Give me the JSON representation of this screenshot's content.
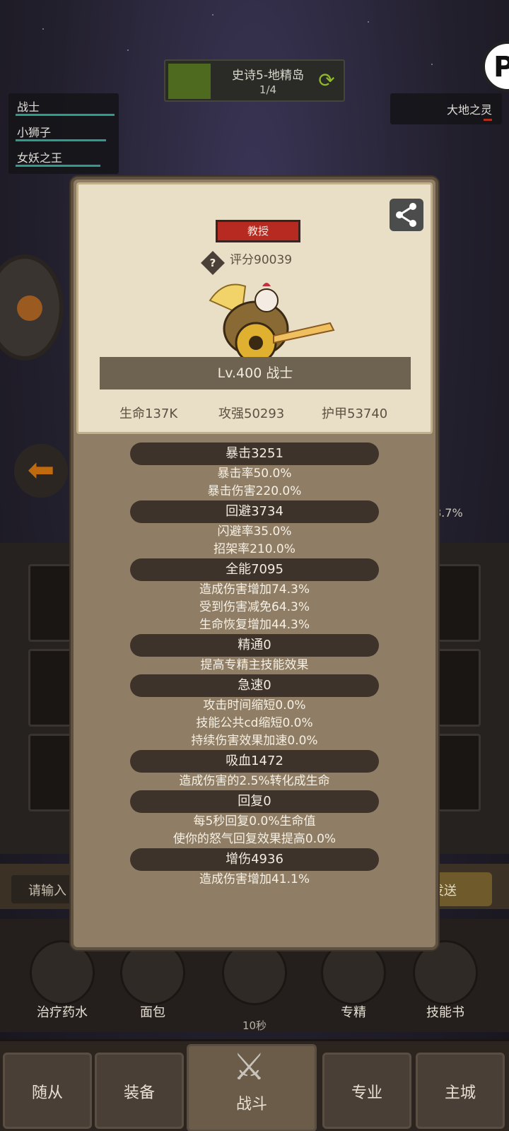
{
  "stage": {
    "name": "史诗5-地精岛",
    "wave": "1/4",
    "thumb_color": "#4d6a1e"
  },
  "party": [
    {
      "name": "战士",
      "hp": 1.0
    },
    {
      "name": "小狮子",
      "hp": 0.92
    },
    {
      "name": "女妖之王",
      "hp": 0.86
    }
  ],
  "enemy": {
    "name": "大地之灵"
  },
  "side_percent": "8.7%",
  "chat": {
    "placeholder": "请输入",
    "send": "发送"
  },
  "skills": [
    {
      "label": "治疗药水",
      "timer": ""
    },
    {
      "label": "面包",
      "timer": ""
    },
    {
      "label": "",
      "timer": "10秒"
    },
    {
      "label": "专精",
      "timer": ""
    },
    {
      "label": "技能书",
      "timer": ""
    }
  ],
  "nav": [
    {
      "label": "随从"
    },
    {
      "label": "装备"
    },
    {
      "label": "战斗"
    },
    {
      "label": "专业"
    },
    {
      "label": "主城"
    }
  ],
  "modal": {
    "badge": "教授",
    "score": "评分90039",
    "name_line": "Lv.400 战士",
    "stats": {
      "hp": "生命137K",
      "atk": "攻强50293",
      "armor": "护甲53740"
    },
    "attributes": [
      {
        "head": "暴击3251",
        "lines": [
          "暴击率50.0%",
          "暴击伤害220.0%"
        ]
      },
      {
        "head": "回避3734",
        "lines": [
          "闪避率35.0%",
          "招架率210.0%"
        ]
      },
      {
        "head": "全能7095",
        "lines": [
          "造成伤害增加74.3%",
          "受到伤害减免64.3%",
          "生命恢复增加44.3%"
        ]
      },
      {
        "head": "精通0",
        "lines": [
          "提高专精主技能效果"
        ]
      },
      {
        "head": "急速0",
        "lines": [
          "攻击时间缩短0.0%",
          "技能公共cd缩短0.0%",
          "持续伤害效果加速0.0%"
        ]
      },
      {
        "head": "吸血1472",
        "lines": [
          "造成伤害的2.5%转化成生命"
        ]
      },
      {
        "head": "回复0",
        "lines": [
          "每5秒回复0.0%生命值",
          "使你的怒气回复效果提高0.0%"
        ]
      },
      {
        "head": "增伤4936",
        "lines": [
          "造成伤害增加41.1%"
        ]
      }
    ]
  },
  "colors": {
    "badge": "#b62a22",
    "hp_bar": "#2e9c8d",
    "modal_bg": "#8f7e65",
    "card_bg": "#e9dfc6"
  }
}
